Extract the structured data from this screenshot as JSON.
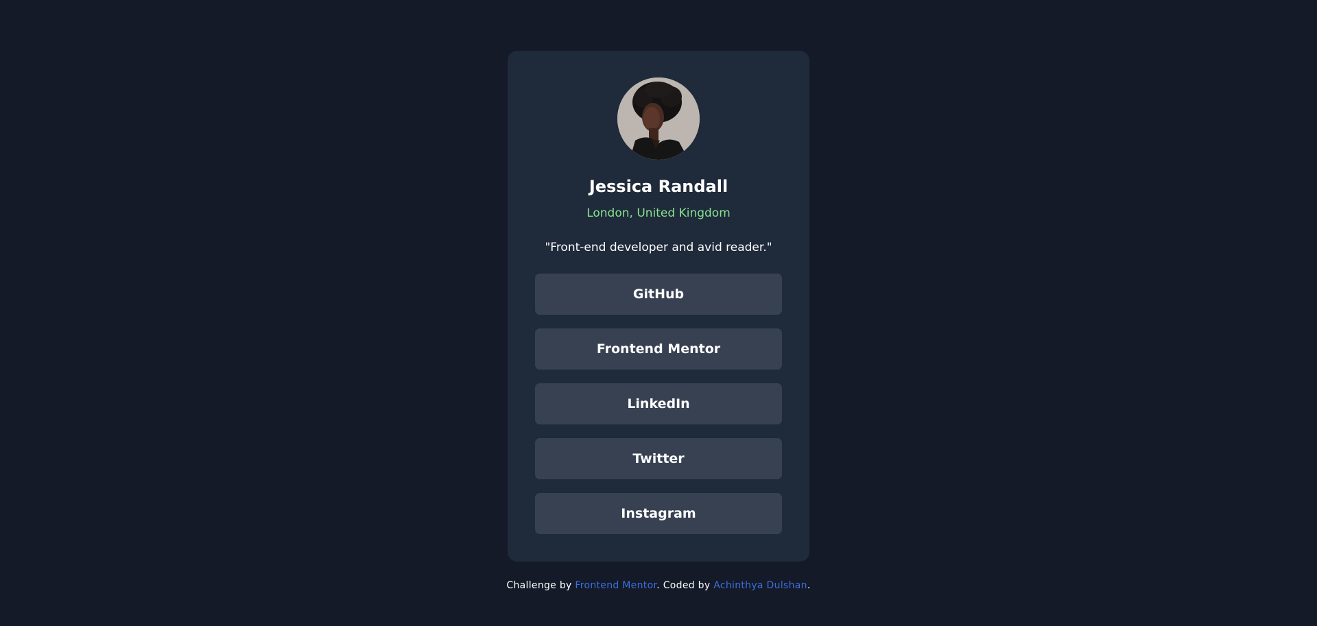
{
  "profile": {
    "name": "Jessica Randall",
    "location": "London, United Kingdom",
    "bio": "\"Front-end developer and avid reader.\""
  },
  "links": [
    {
      "label": "GitHub"
    },
    {
      "label": "Frontend Mentor"
    },
    {
      "label": "LinkedIn"
    },
    {
      "label": "Twitter"
    },
    {
      "label": "Instagram"
    }
  ],
  "footer": {
    "prefix": "Challenge by ",
    "challenge_link": "Frontend Mentor",
    "middle": ". Coded by ",
    "author_link": "Achinthya Dulshan",
    "suffix": "."
  },
  "colors": {
    "background": "#141a28",
    "card": "#1f2a3a",
    "button": "#374152",
    "accent_green": "#86e28f",
    "link_blue": "#3e6fe0"
  }
}
